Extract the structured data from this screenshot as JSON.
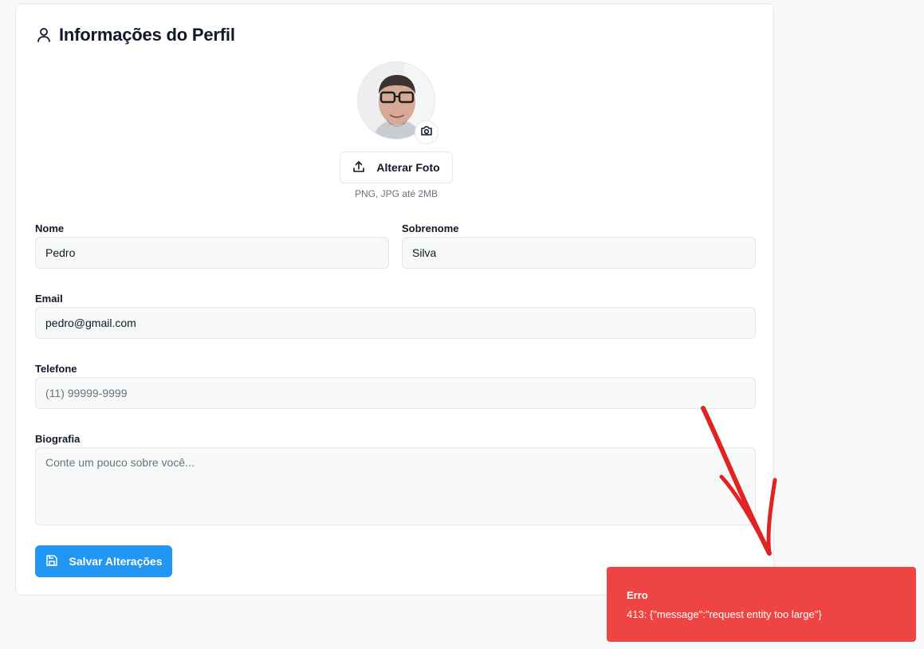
{
  "profile": {
    "title": "Informações do Perfil",
    "title_icon": "user-icon",
    "avatar_alt": "Foto de perfil",
    "change_photo_label": "Alterar Foto",
    "photo_hint": "PNG, JPG até 2MB"
  },
  "form": {
    "first_name": {
      "label": "Nome",
      "value": "Pedro"
    },
    "last_name": {
      "label": "Sobrenome",
      "value": "Silva"
    },
    "email": {
      "label": "Email",
      "value": "pedro@gmail.com"
    },
    "phone": {
      "label": "Telefone",
      "value": "",
      "placeholder": "(11) 99999-9999"
    },
    "bio": {
      "label": "Biografia",
      "value": "",
      "placeholder": "Conte um pouco sobre você..."
    },
    "save_label": "Salvar Alterações"
  },
  "toast": {
    "title": "Erro",
    "message": "413: {\"message\":\"request entity too large\"}",
    "color": "#ef4444"
  },
  "colors": {
    "primary": "#2196f3",
    "annotation": "#e02424"
  }
}
